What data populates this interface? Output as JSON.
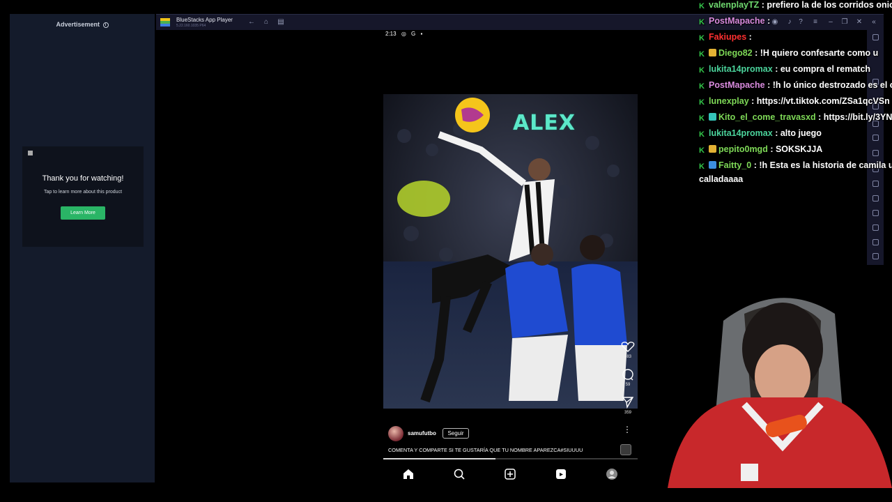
{
  "ad": {
    "label": "Advertisement",
    "title": "Thank you for watching!",
    "subtitle": "Tap to learn more about this product",
    "button": "Learn More"
  },
  "bluestacks": {
    "title": "BlueStacks App Player",
    "version": "5.22.160.1035 P64",
    "nav_icons": [
      "back-icon",
      "home-icon",
      "recent-apps-icon"
    ],
    "window_controls": [
      "account-icon",
      "notification-icon",
      "help-icon",
      "menu-icon",
      "minimize-icon",
      "restore-icon",
      "close-icon",
      "collapse-sidebar-icon"
    ]
  },
  "status_bar": {
    "time": "2:13",
    "icons": [
      "instagram-icon",
      "google-icon",
      "notification-icon"
    ]
  },
  "reel": {
    "overlay_text": "ALEX",
    "likes": "383",
    "comments": "59",
    "shares": "359",
    "username": "samufutbo",
    "follow_label": "Seguir",
    "caption": "COMENTA Y COMPARTE SI TE GUSTARÍA QUE TU NOMBRE APAREZCA#SIUUUU",
    "progress": 0.44
  },
  "bottom_nav": [
    "home-icon",
    "search-icon",
    "create-icon",
    "reels-icon",
    "profile-icon"
  ],
  "chat": [
    {
      "user": "valenplayTZ",
      "color": "#6fd96f",
      "badges": [
        "sword"
      ],
      "msg": ": prefiero la de los corridos onic"
    },
    {
      "user": "PostMapache",
      "color": "#d98bde",
      "badges": [
        "sword"
      ],
      "msg": ":"
    },
    {
      "user": "Fakiupes",
      "color": "#ff3030",
      "badges": [
        "sword"
      ],
      "msg": ":"
    },
    {
      "user": "Diego82",
      "color": "#7ed957",
      "badges": [
        "sword",
        "sub"
      ],
      "msg": ": !H quiero confesarte",
      "msg2": "como u"
    },
    {
      "user": "lukita14promax",
      "color": "#4bd49c",
      "badges": [
        "sword"
      ],
      "msg": ": eu compra el rematch"
    },
    {
      "user": "PostMapache",
      "color": "#d98bde",
      "badges": [
        "sword"
      ],
      "msg": ": !h lo único destrozado es el c"
    },
    {
      "user": "lunexplay",
      "color": "#7ed957",
      "badges": [
        "sword"
      ],
      "msg": ": https://vt.tiktok.com/ZSa1qcVSn"
    },
    {
      "user": "Kito_el_come_travasxd",
      "color": "#7ed957",
      "badges": [
        "sword",
        "teal"
      ],
      "msg": ": https://bit.ly/3YN"
    },
    {
      "user": "lukita14promax",
      "color": "#4bd49c",
      "badges": [
        "sword"
      ],
      "msg": ": alto juego"
    },
    {
      "user": "pepito0mgd",
      "color": "#7ed957",
      "badges": [
        "sword",
        "sub"
      ],
      "msg": ": SOKSKJJA"
    },
    {
      "user": "Faitty_0",
      "color": "#7ed957",
      "badges": [
        "sword",
        "blue"
      ],
      "msg": ": !h Esta es la historia de camila u",
      "msg2_line": "calladaaaa"
    }
  ],
  "colors": {
    "ad_button": "#2ab566",
    "reel_overlay_text": "#5ce8c9",
    "bluestacks_titlebar": "#16172a"
  }
}
